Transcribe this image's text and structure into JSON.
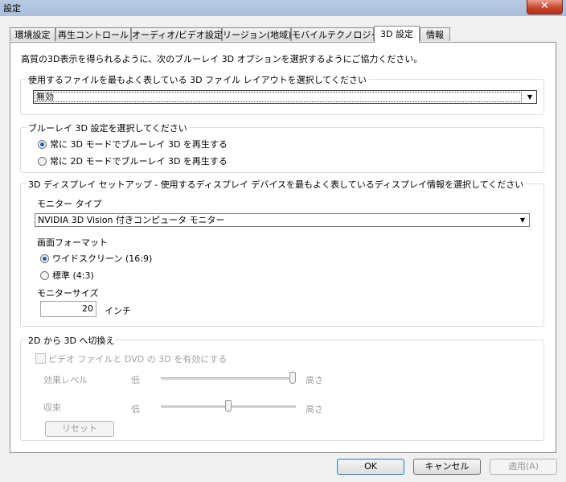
{
  "window": {
    "title": "設定",
    "close_glyph": "✕"
  },
  "tabs": [
    {
      "label": "環境設定"
    },
    {
      "label": "再生コントロール"
    },
    {
      "label": "オーディオ/ビデオ設定"
    },
    {
      "label": "リージョン(地域)"
    },
    {
      "label": "モバイルテクノロジー"
    },
    {
      "label": "3D 設定",
      "active": true
    },
    {
      "label": "情報"
    }
  ],
  "intro": "高質の3D表示を得られるように、次のブルーレイ 3D オプションを選択するようにご協力ください。",
  "layout_group": {
    "legend": "使用するファイルを最もよく表している 3D ファイル レイアウトを選択してください",
    "selected": "無効"
  },
  "bluray_group": {
    "legend": "ブルーレイ 3D 設定を選択してください",
    "options": [
      {
        "label": "常に 3D モードでブルーレイ 3D を再生する",
        "checked": true
      },
      {
        "label": "常に 2D モードでブルーレイ 3D を再生する",
        "checked": false
      }
    ]
  },
  "display_group": {
    "legend": "3D ディスプレイ セットアップ - 使用するディスプレイ デバイスを最もよく表しているディスプレイ情報を選択してください",
    "monitor_type_label": "モニター タイプ",
    "monitor_type_value": "NVIDIA 3D Vision 付きコンピュータ モニター",
    "screen_format_label": "画面フォーマット",
    "screen_format_options": [
      {
        "label": "ワイドスクリーン (16:9)",
        "checked": true
      },
      {
        "label": "標準 (4:3)",
        "checked": false
      }
    ],
    "monitor_size_label": "モニターサイズ",
    "monitor_size_value": "20",
    "monitor_size_unit": "インチ"
  },
  "conversion_group": {
    "legend": "2D から 3D へ切換え",
    "checkbox_label": "ビデオ ファイルと DVD の 3D を有効にする",
    "checkbox_checked": false,
    "effect_label": "効果レベル",
    "effect_low": "低",
    "effect_high": "高さ",
    "effect_level": 1.0,
    "convergence_label": "収束",
    "convergence_low": "低",
    "convergence_high": "高さ",
    "convergence_level": 0.5,
    "reset_label": "リセット"
  },
  "buttons": {
    "ok": "OK",
    "cancel": "キャンセル",
    "apply": "適用(A)"
  }
}
